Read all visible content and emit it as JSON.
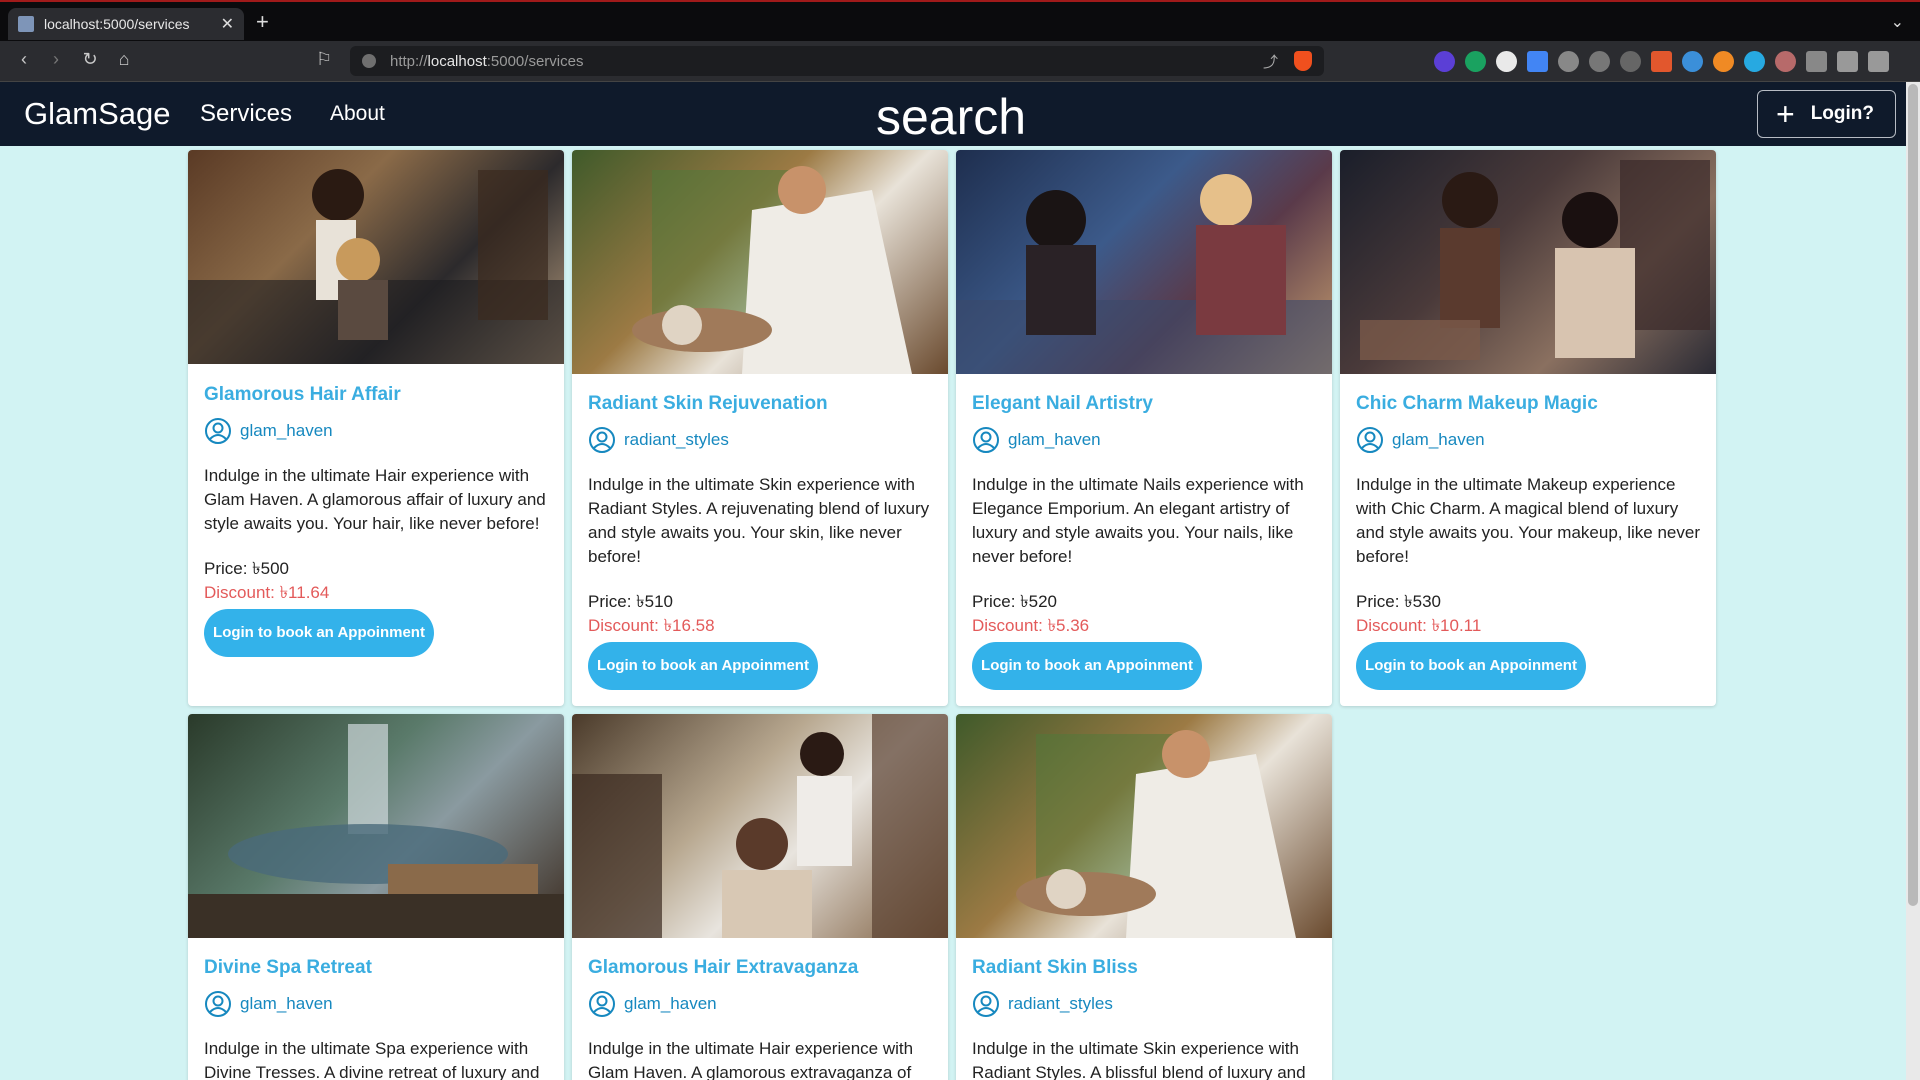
{
  "browser": {
    "tab_title": "localhost:5000/services",
    "url_prefix": "http://",
    "url_host": "localhost",
    "url_path": ":5000/services"
  },
  "nav": {
    "brand": "GlamSage",
    "services": "Services",
    "about": "About",
    "search": "search",
    "login": "Login?"
  },
  "services": [
    {
      "title": "Glamorous Hair Affair",
      "owner": "glam_haven",
      "description": "Indulge in the ultimate Hair experience with Glam Haven. A glamorous affair of luxury and style awaits you. Your hair, like never before!",
      "price": "Price: ৳500",
      "discount": "Discount: ৳11.64",
      "button": "Login to book an Appoinment"
    },
    {
      "title": "Radiant Skin Rejuvenation",
      "owner": "radiant_styles",
      "description": "Indulge in the ultimate Skin experience with Radiant Styles. A rejuvenating blend of luxury and style awaits you. Your skin, like never before!",
      "price": "Price: ৳510",
      "discount": "Discount: ৳16.58",
      "button": "Login to book an Appoinment"
    },
    {
      "title": "Elegant Nail Artistry",
      "owner": "glam_haven",
      "description": "Indulge in the ultimate Nails experience with Elegance Emporium. An elegant artistry of luxury and style awaits you. Your nails, like never before!",
      "price": "Price: ৳520",
      "discount": "Discount: ৳5.36",
      "button": "Login to book an Appoinment"
    },
    {
      "title": "Chic Charm Makeup Magic",
      "owner": "glam_haven",
      "description": "Indulge in the ultimate Makeup experience with Chic Charm. A magical blend of luxury and style awaits you. Your makeup, like never before!",
      "price": "Price: ৳530",
      "discount": "Discount: ৳10.11",
      "button": "Login to book an Appoinment"
    },
    {
      "title": "Divine Spa Retreat",
      "owner": "glam_haven",
      "description": "Indulge in the ultimate Spa experience with Divine Tresses. A divine retreat of luxury and"
    },
    {
      "title": "Glamorous Hair Extravaganza",
      "owner": "glam_haven",
      "description": "Indulge in the ultimate Hair experience with Glam Haven. A glamorous extravaganza of"
    },
    {
      "title": "Radiant Skin Bliss",
      "owner": "radiant_styles",
      "description": "Indulge in the ultimate Skin experience with Radiant Styles. A blissful blend of luxury and"
    }
  ]
}
